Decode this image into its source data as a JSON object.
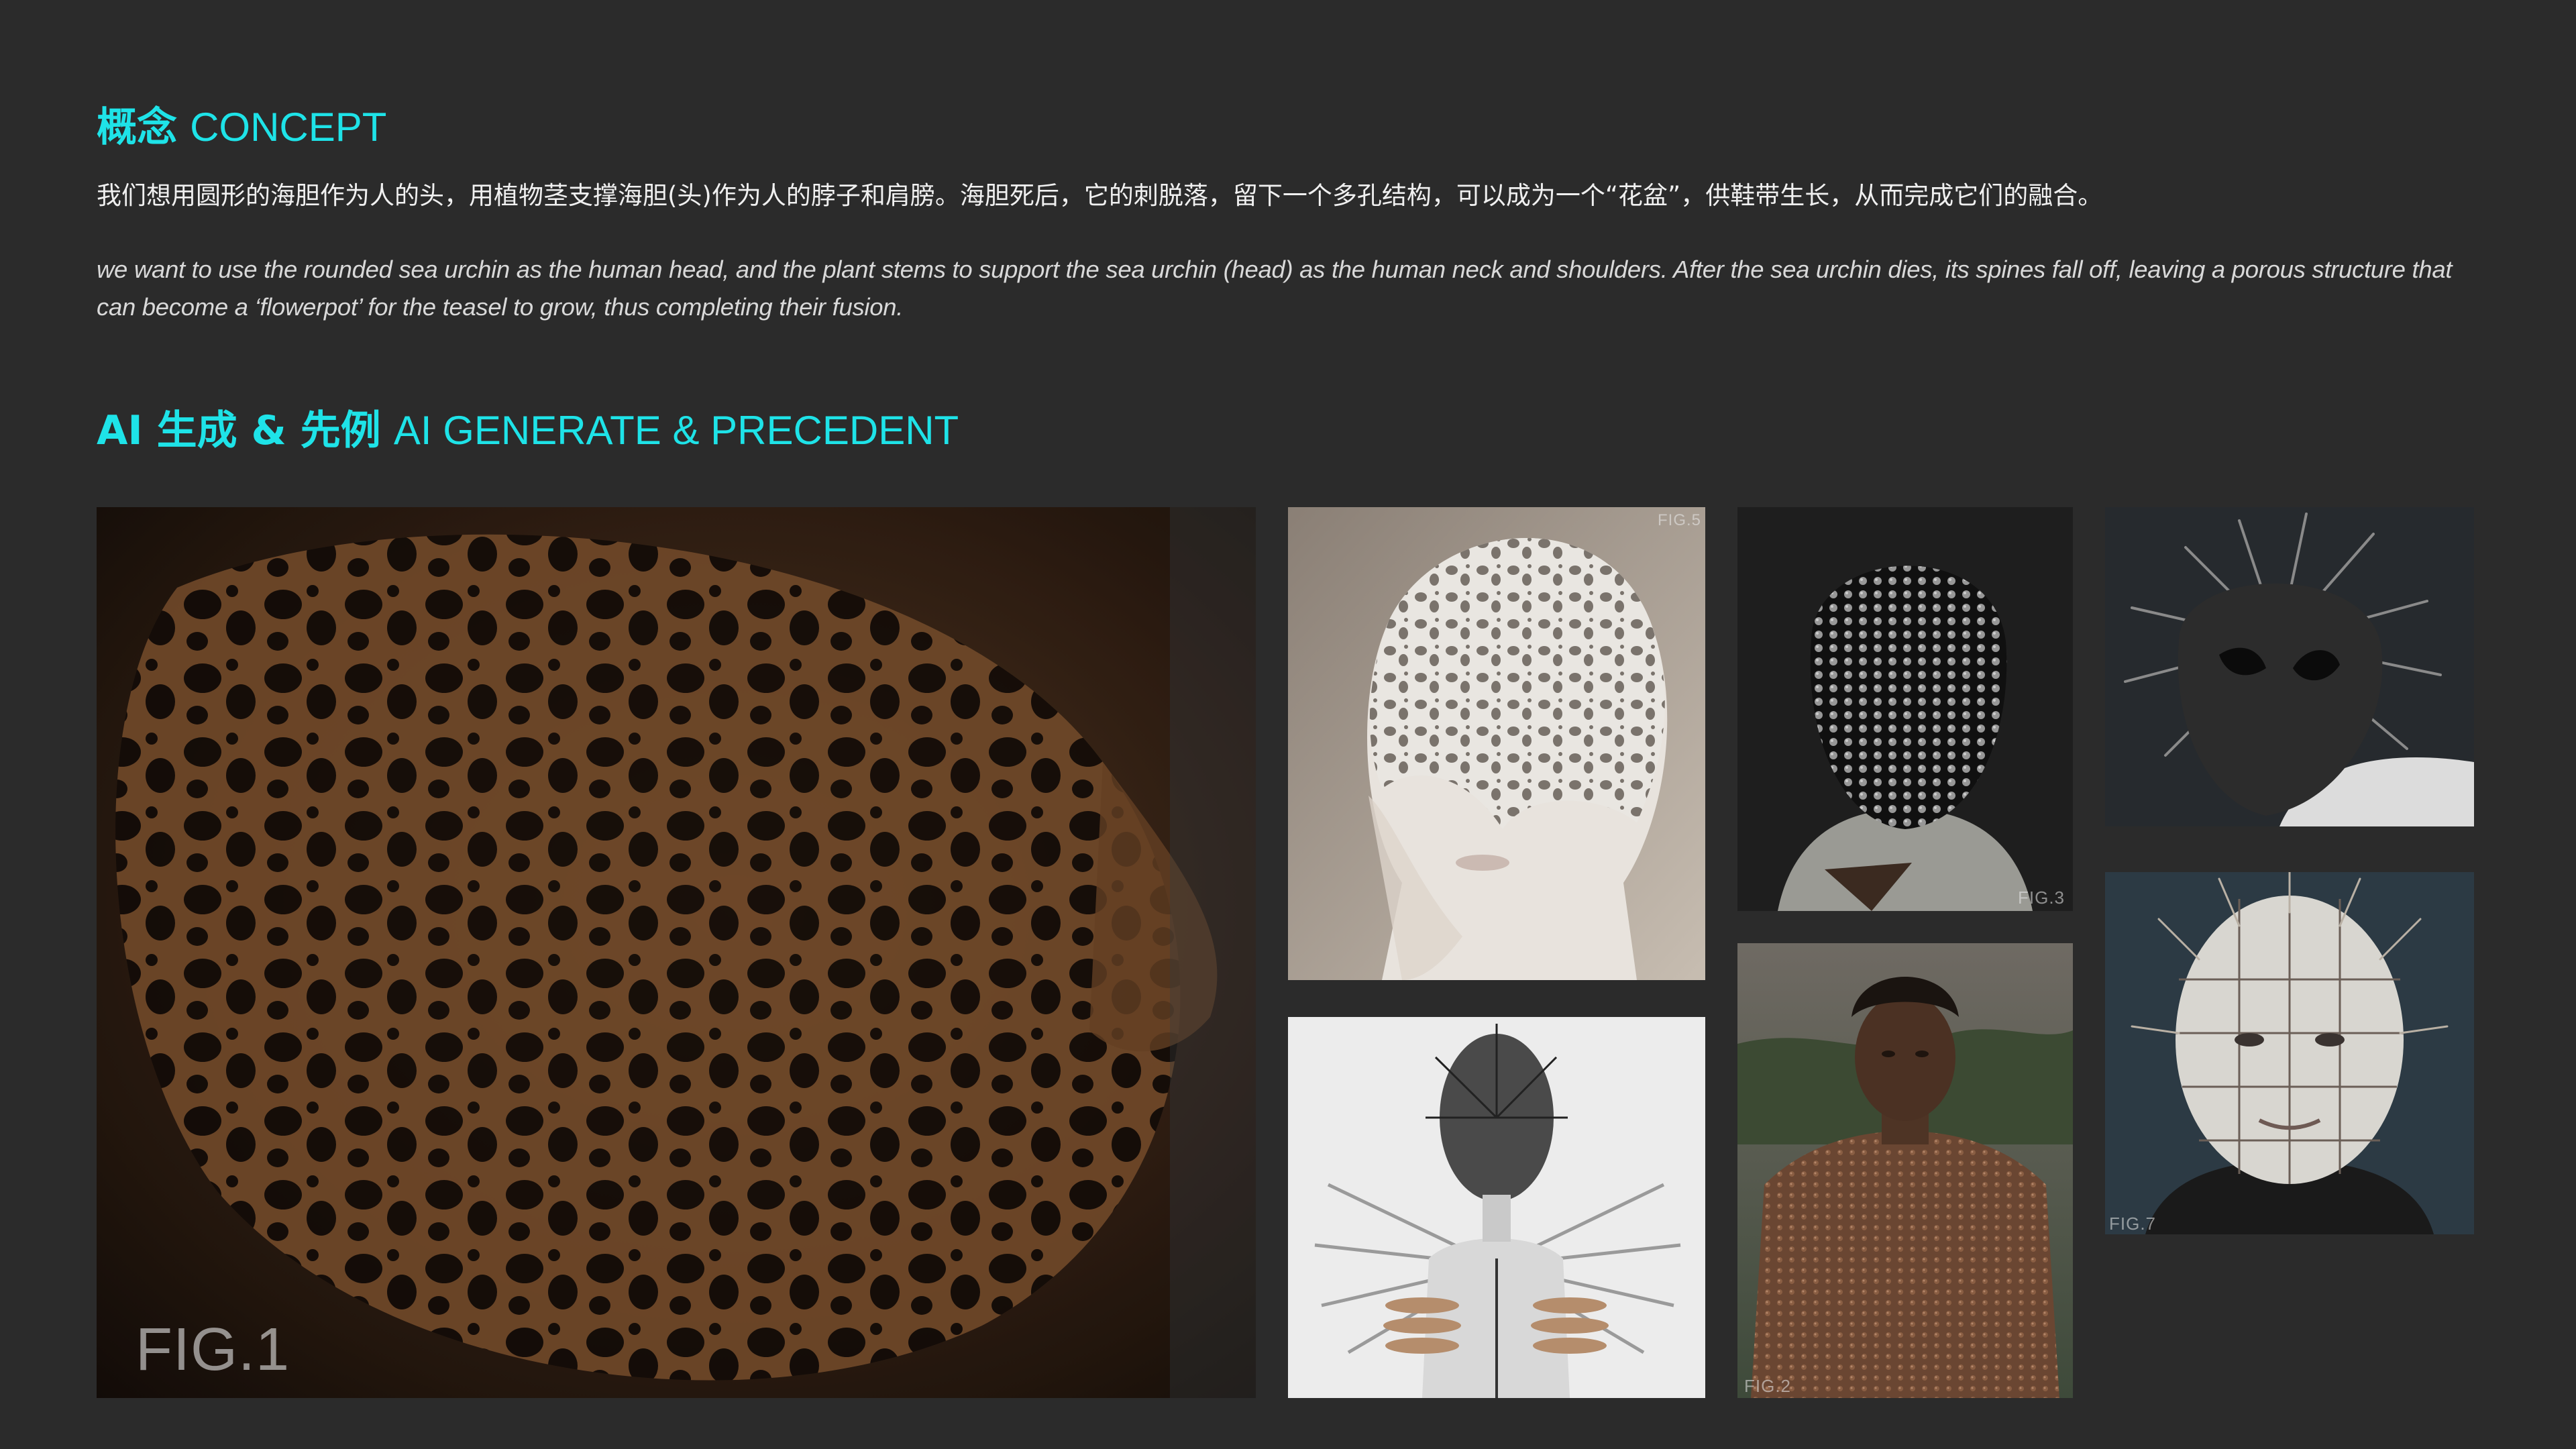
{
  "concept": {
    "title_zh": "概念",
    "title_en": "CONCEPT",
    "text_zh": "我们想用圆形的海胆作为人的头，用植物茎支撑海胆(头)作为人的脖子和肩膀。海胆死后，它的刺脱落，留下一个多孔结构，可以成为一个“花盆”，供鞋带生长，从而完成它们的融合。",
    "text_en": "we want to use the rounded sea urchin as the human head, and the plant stems to support the sea urchin (head) as the human neck and shoulders. After the sea urchin dies, its spines fall off, leaving a porous structure that can become a ‘flowerpot’ for the teasel to grow, thus completing their fusion."
  },
  "ai_section": {
    "title_zh": "AI 生成 & 先例",
    "title_en": "AI GENERATE & PRECEDENT"
  },
  "figures": {
    "fig1": {
      "label": "FIG.1",
      "subject": "porous-sea-urchin-face"
    },
    "fig2": {
      "label": "FIG.2",
      "subject": "man-with-textured-skin"
    },
    "fig3": {
      "label": "FIG.3",
      "subject": "studded-black-mask"
    },
    "fig4": {
      "label": "",
      "subject": "spiked-mask"
    },
    "fig5": {
      "label": "FIG.5",
      "subject": "lace-head-covering"
    },
    "fig6": {
      "label": "",
      "subject": "spiked-head-figure"
    },
    "fig7": {
      "label": "FIG.7",
      "subject": "pinhead-face"
    }
  },
  "colors": {
    "background": "#2b2b2b",
    "accent": "#1ee3e8",
    "body_text": "#f0f0f0"
  }
}
